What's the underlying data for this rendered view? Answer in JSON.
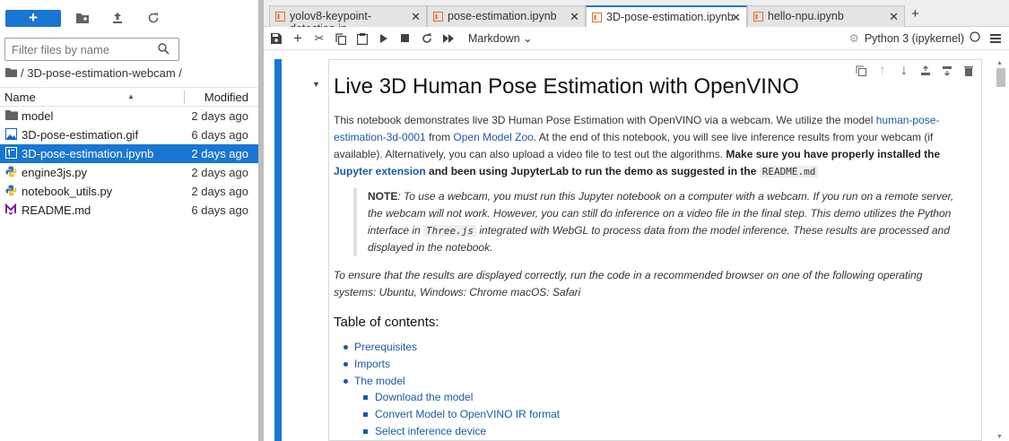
{
  "toolbar": {
    "new_label": "+"
  },
  "filter": {
    "placeholder": "Filter files by name"
  },
  "breadcrumb": {
    "path": "/ 3D-pose-estimation-webcam /"
  },
  "filelist": {
    "col_name": "Name",
    "col_modified": "Modified",
    "files": [
      {
        "name": "model",
        "modified": "2 days ago",
        "icon": "folder-icon"
      },
      {
        "name": "3D-pose-estimation.gif",
        "modified": "6 days ago",
        "icon": "image-icon"
      },
      {
        "name": "3D-pose-estimation.ipynb",
        "modified": "2 days ago",
        "icon": "notebook-icon",
        "selected": true
      },
      {
        "name": "engine3js.py",
        "modified": "2 days ago",
        "icon": "python-icon"
      },
      {
        "name": "notebook_utils.py",
        "modified": "2 days ago",
        "icon": "python-icon"
      },
      {
        "name": "README.md",
        "modified": "6 days ago",
        "icon": "markdown-icon"
      }
    ]
  },
  "tabs": [
    {
      "label": "yolov8-keypoint-detection.ip"
    },
    {
      "label": "pose-estimation.ipynb"
    },
    {
      "label": "3D-pose-estimation.ipynb",
      "active": true
    },
    {
      "label": "hello-npu.ipynb"
    }
  ],
  "nbtoolbar": {
    "cell_type": "Markdown",
    "kernel": "Python 3 (ipykernel)"
  },
  "cell": {
    "title": "Live 3D Human Pose Estimation with OpenVINO",
    "p1_a": "This notebook demonstrates live 3D Human Pose Estimation with OpenVINO via a webcam. We utilize the model ",
    "p1_link1": "human-pose-estimation-3d-0001",
    "p1_b": " from ",
    "p1_link2": "Open Model Zoo",
    "p1_c": ". At the end of this notebook, you will see live inference results from your webcam (if available). Alternatively, you can also upload a video file to test out the algorithms. ",
    "p1_bold": "Make sure you have properly installed the ",
    "p1_link3": "Jupyter extension",
    "p1_bold2": " and been using JupyterLab to run the demo as suggested in the ",
    "p1_code": "README.md",
    "note_label": "NOTE",
    "note_a": ": To use a webcam, you must run this Jupyter notebook on a computer with a webcam. If you run on a remote server, the webcam will not work. However, you can still do inference on a video file in the final step. This demo utilizes the Python interface in ",
    "note_code": "Three.js",
    "note_b": " integrated with WebGL to process data from the model inference. These results are processed and displayed in the notebook.",
    "p2": "To ensure that the results are displayed correctly, run the code in a recommended browser on one of the following operating systems: Ubuntu, Windows: Chrome macOS: Safari",
    "toc_title": "Table of contents:",
    "toc": [
      "Prerequisites",
      "Imports",
      "The model"
    ],
    "toc_sub": [
      "Download the model",
      "Convert Model to OpenVINO IR format",
      "Select inference device"
    ]
  },
  "colors": {
    "accent": "#1976d2",
    "link": "#1a5aa6"
  }
}
